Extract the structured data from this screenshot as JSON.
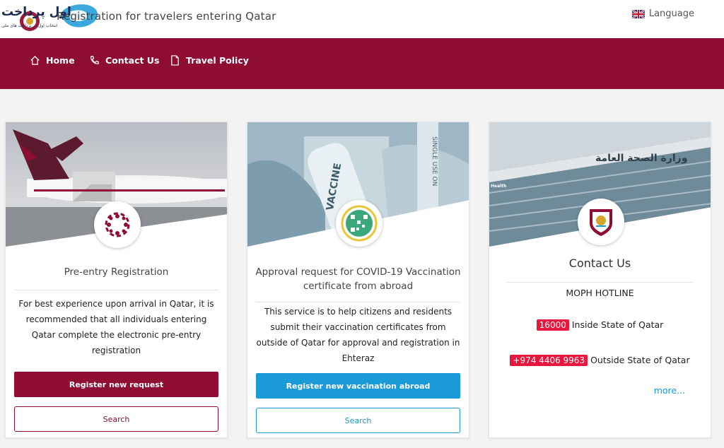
{
  "header": {
    "logo_text": "اول پرداخت",
    "logo_subtext": "انتخاب اول در پرداخت های ملی",
    "site_title": "Registration for travelers entering Qatar",
    "language_label": "Language",
    "flag_icon": "uk-flag-icon"
  },
  "nav": {
    "items": [
      {
        "label": "Home",
        "icon": "home-icon"
      },
      {
        "label": "Contact Us",
        "icon": "phone-icon"
      },
      {
        "label": "Travel Policy",
        "icon": "document-icon"
      }
    ]
  },
  "cards": [
    {
      "title": "Pre-entry Registration",
      "description": "For best experience upon arrival in Qatar, it is recommended that all individuals entering Qatar complete the electronic pre-entry registration",
      "primary_button": "Register new request",
      "secondary_button": "Search",
      "accent": "#8f0c32"
    },
    {
      "title": "Approval request for COVID-19 Vaccination certificate from abroad",
      "description": "This service is to help citizens and residents submit their vaccination certificates from outside of Qatar for approval and registration in Ehteraz",
      "primary_button": "Register new vaccination abroad",
      "secondary_button": "Search",
      "accent": "#1a9ad6"
    },
    {
      "title": "Contact Us",
      "subtitle": "MOPH HOTLINE",
      "hotline_inside_number": "16000",
      "hotline_inside_label": "Inside State of Qatar",
      "hotline_outside_number": "+974 4406 9963",
      "hotline_outside_label": "Outside State of Qatar",
      "more_link": "more...",
      "building_sign": "وزارة الصحة العامة",
      "building_sign_en": "Health"
    }
  ],
  "colors": {
    "brand": "#8f0c32",
    "accent_blue": "#1a9ad6",
    "hotline_badge": "#e8173e"
  }
}
